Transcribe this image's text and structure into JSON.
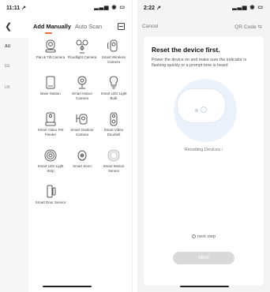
{
  "left_phone": {
    "status_time": "11:11 ↗",
    "status_icons": "▂▃▅ ◉ ▭",
    "tabs": {
      "manual": "Add Manually",
      "auto": "Auto Scan"
    },
    "regions": [
      "AU",
      "EE",
      "UK"
    ],
    "devices": [
      {
        "label": "Pan & Tilt Camera",
        "icon": "pan-tilt-camera-icon"
      },
      {
        "label": "Floodlight Camera",
        "icon": "floodlight-camera-icon"
      },
      {
        "label": "Smart Wireless Camera",
        "icon": "wireless-camera-icon"
      },
      {
        "label": "Base Station",
        "icon": "base-station-icon"
      },
      {
        "label": "Smart Indoor Camera",
        "icon": "indoor-camera-icon"
      },
      {
        "label": "Smart LED Light Bulb",
        "icon": "light-bulb-icon"
      },
      {
        "label": "Smart Video Pet Feeder",
        "icon": "pet-feeder-icon"
      },
      {
        "label": "Smart Outdoor Camera",
        "icon": "outdoor-camera-icon"
      },
      {
        "label": "Smart Video Doorbell",
        "icon": "doorbell-icon"
      },
      {
        "label": "Smart LED Light Strip",
        "icon": "light-strip-icon"
      },
      {
        "label": "Smart Siren",
        "icon": "siren-icon"
      },
      {
        "label": "Smart Motion Sensor",
        "icon": "motion-sensor-icon"
      },
      {
        "label": "Smart Door Sensor",
        "icon": "door-sensor-icon"
      }
    ]
  },
  "right_phone": {
    "status_time": "2:22 ↗",
    "status_icons": "▂▃▅ ◉ ▭",
    "cancel": "Cancel",
    "qr_code": "QR Code ⇆",
    "title": "Reset the device first.",
    "description": "Power the device on and make sure the indicator is flashing quickly or a prompt tone is heard",
    "reset_link": "Resetting Devices ›",
    "next_step": "next step",
    "next_button": "Next"
  },
  "colors": {
    "accent": "#f06a3c",
    "illustration_bg": "#eaf1fb",
    "disabled_button": "#d9d9d9"
  }
}
